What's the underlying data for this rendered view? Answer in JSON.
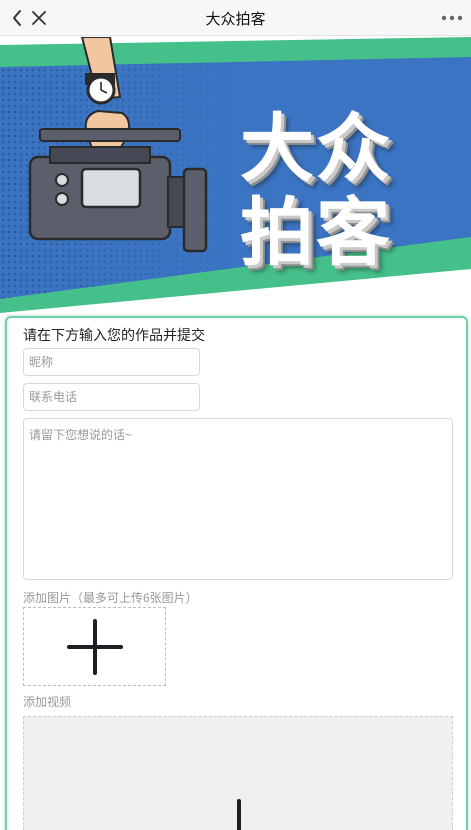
{
  "navbar": {
    "title": "大众拍客",
    "back_icon": "chevron-left-icon",
    "close_icon": "close-icon",
    "more_icon": "more-dots-icon"
  },
  "banner": {
    "title_text": "大众\n拍客",
    "colors": {
      "blue": "#3b74c2",
      "green": "#45c08a",
      "white": "#ffffff"
    }
  },
  "form": {
    "heading": "请在下方输入您的作品并提交",
    "nickname_placeholder": "昵称",
    "phone_placeholder": "联系电话",
    "message_placeholder": "请留下您想说的话~",
    "photo_label": "添加图片（最多可上传6张图片）",
    "video_label": "添加视频",
    "accent_color": "#6fd0a5"
  }
}
